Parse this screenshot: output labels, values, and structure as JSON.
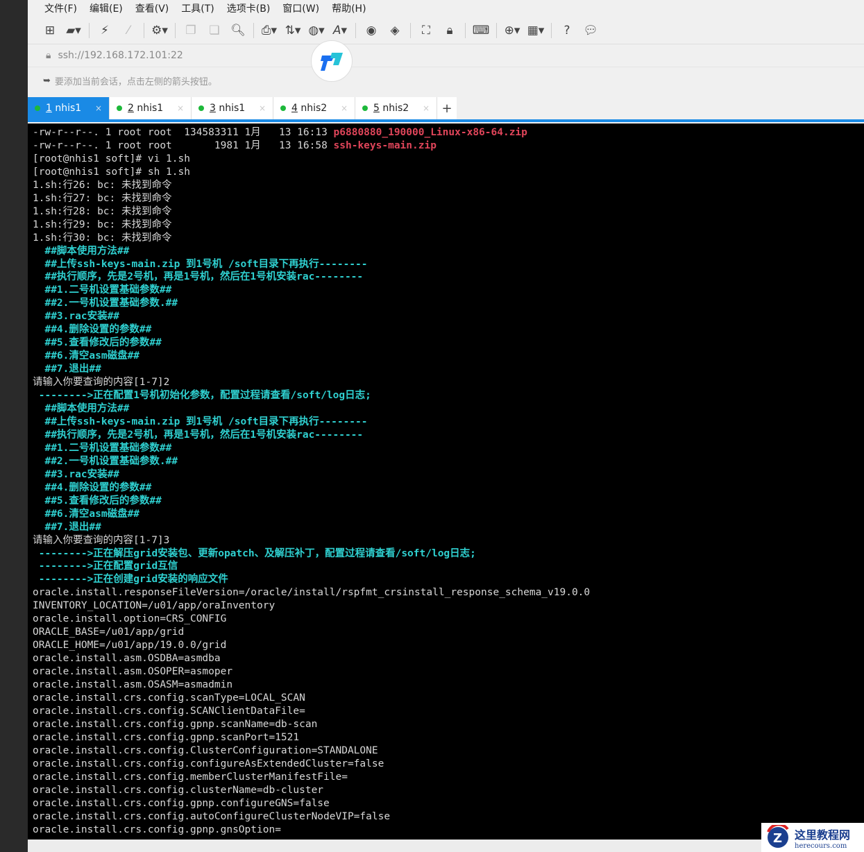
{
  "menu": [
    "文件(F)",
    "编辑(E)",
    "查看(V)",
    "工具(T)",
    "选项卡(B)",
    "窗口(W)",
    "帮助(H)"
  ],
  "address": "ssh://192.168.172.101:22",
  "hint": "要添加当前会话，点击左侧的箭头按钮。",
  "tabs": [
    {
      "num": "1",
      "label": "nhis1"
    },
    {
      "num": "2",
      "label": "nhis1"
    },
    {
      "num": "3",
      "label": "nhis1"
    },
    {
      "num": "4",
      "label": "nhis2"
    },
    {
      "num": "5",
      "label": "nhis2"
    }
  ],
  "new_tab": "+",
  "terminal": [
    {
      "t": "-rw-r--r--. 1 root root  134583311 1月   13 16:13 ",
      "r": "p6880880_190000_Linux-x86-64.zip"
    },
    {
      "t": "-rw-r--r--. 1 root root       1981 1月   13 16:58 ",
      "r": "ssh-keys-main.zip"
    },
    {
      "t": "[root@nhis1 soft]# vi 1.sh"
    },
    {
      "t": "[root@nhis1 soft]# sh 1.sh"
    },
    {
      "t": "1.sh:行26: bc: 未找到命令"
    },
    {
      "t": "1.sh:行27: bc: 未找到命令"
    },
    {
      "t": "1.sh:行28: bc: 未找到命令"
    },
    {
      "t": "1.sh:行29: bc: 未找到命令"
    },
    {
      "t": "1.sh:行30: bc: 未找到命令"
    },
    {
      "c": "  ##脚本使用方法##"
    },
    {
      "c": "  ##上传ssh-keys-main.zip 到1号机 /soft目录下再执行--------"
    },
    {
      "c": "  ##执行顺序，先是2号机，再是1号机，然后在1号机安装rac--------"
    },
    {
      "c": "  ##1.二号机设置基础参数##"
    },
    {
      "c": "  ##2.一号机设置基础参数.##"
    },
    {
      "c": "  ##3.rac安装##"
    },
    {
      "c": "  ##4.删除设置的参数##"
    },
    {
      "c": "  ##5.查看修改后的参数##"
    },
    {
      "c": "  ##6.清空asm磁盘##"
    },
    {
      "c": "  ##7.退出##"
    },
    {
      "t": "请输入你要查询的内容[1-7]2"
    },
    {
      "c": " -------->正在配置1号机初始化参数，配置过程请查看/soft/log日志;"
    },
    {
      "c": "  ##脚本使用方法##"
    },
    {
      "c": "  ##上传ssh-keys-main.zip 到1号机 /soft目录下再执行--------"
    },
    {
      "c": "  ##执行顺序，先是2号机，再是1号机，然后在1号机安装rac--------"
    },
    {
      "c": "  ##1.二号机设置基础参数##"
    },
    {
      "c": "  ##2.一号机设置基础参数.##"
    },
    {
      "c": "  ##3.rac安装##"
    },
    {
      "c": "  ##4.删除设置的参数##"
    },
    {
      "c": "  ##5.查看修改后的参数##"
    },
    {
      "c": "  ##6.清空asm磁盘##"
    },
    {
      "c": "  ##7.退出##"
    },
    {
      "t": "请输入你要查询的内容[1-7]3"
    },
    {
      "c": " -------->正在解压grid安装包、更新opatch、及解压补丁，配置过程请查看/soft/log日志;"
    },
    {
      "c": " -------->正在配置grid互信"
    },
    {
      "c": " -------->正在创建grid安装的响应文件"
    },
    {
      "t": "oracle.install.responseFileVersion=/oracle/install/rspfmt_crsinstall_response_schema_v19.0.0"
    },
    {
      "t": "INVENTORY_LOCATION=/u01/app/oraInventory"
    },
    {
      "t": "oracle.install.option=CRS_CONFIG"
    },
    {
      "t": "ORACLE_BASE=/u01/app/grid"
    },
    {
      "t": "ORACLE_HOME=/u01/app/19.0.0/grid"
    },
    {
      "t": "oracle.install.asm.OSDBA=asmdba"
    },
    {
      "t": "oracle.install.asm.OSOPER=asmoper"
    },
    {
      "t": "oracle.install.asm.OSASM=asmadmin"
    },
    {
      "t": "oracle.install.crs.config.scanType=LOCAL_SCAN"
    },
    {
      "t": "oracle.install.crs.config.SCANClientDataFile="
    },
    {
      "t": "oracle.install.crs.config.gpnp.scanName=db-scan"
    },
    {
      "t": "oracle.install.crs.config.gpnp.scanPort=1521"
    },
    {
      "t": "oracle.install.crs.config.ClusterConfiguration=STANDALONE"
    },
    {
      "t": "oracle.install.crs.config.configureAsExtendedCluster=false"
    },
    {
      "t": "oracle.install.crs.config.memberClusterManifestFile="
    },
    {
      "t": "oracle.install.crs.config.clusterName=db-cluster"
    },
    {
      "t": "oracle.install.crs.config.gpnp.configureGNS=false"
    },
    {
      "t": "oracle.install.crs.config.autoConfigureClusterNodeVIP=false"
    },
    {
      "t": "oracle.install.crs.config.gpnp.gnsOption="
    }
  ],
  "watermark": {
    "title": "这里教程网",
    "url": "herecours.com"
  }
}
